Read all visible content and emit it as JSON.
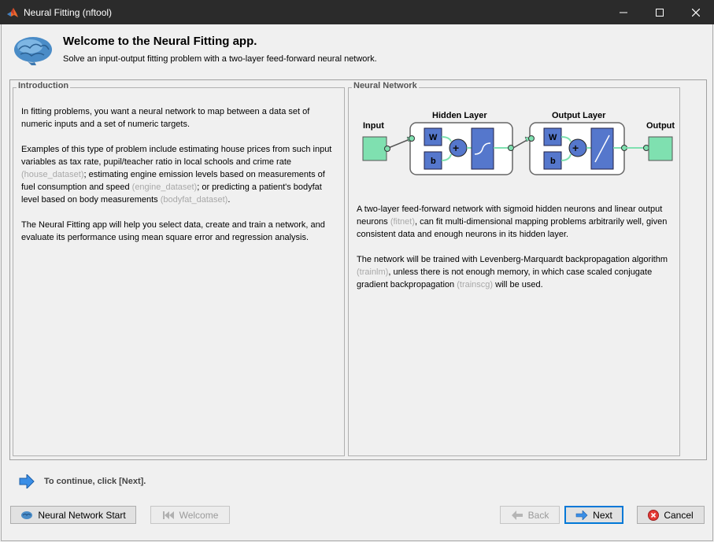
{
  "window": {
    "title": "Neural Fitting (nftool)",
    "controls": {
      "minimize": "—",
      "maximize": "☐",
      "close": "✕"
    }
  },
  "header": {
    "title": "Welcome to the Neural Fitting app.",
    "subtitle": "Solve an input-output fitting problem with a two-layer feed-forward neural network."
  },
  "introduction": {
    "legend": "Introduction",
    "p1": "In fitting problems, you want a neural network to map between a data set of numeric inputs and a set of numeric targets.",
    "p2_a": "Examples of this type of problem include estimating house prices from such input variables as tax rate, pupil/teacher ratio in local schools and crime rate ",
    "p2_link1": "(house_dataset)",
    "p2_b": "; estimating engine emission levels based on measurements of fuel consumption and speed ",
    "p2_link2": "(engine_dataset)",
    "p2_c": "; or predicting a patient's bodyfat level based on body measurements ",
    "p2_link3": "(bodyfat_dataset)",
    "p2_d": ".",
    "p3": "The Neural Fitting app will help you select data, create and train a network, and evaluate its performance using mean square error and regression analysis."
  },
  "network": {
    "legend": "Neural Network",
    "diagram": {
      "input_label": "Input",
      "hidden_label": "Hidden Layer",
      "output_layer_label": "Output Layer",
      "output_label": "Output",
      "w": "W",
      "b": "b",
      "plus": "+"
    },
    "p1_a": "A two-layer feed-forward network with sigmoid hidden neurons and linear output neurons ",
    "p1_link": "(fitnet)",
    "p1_b": ", can fit multi-dimensional mapping problems arbitrarily well, given consistent data and enough neurons in its hidden layer.",
    "p2_a": "The network will be trained with Levenberg-Marquardt backpropagation algorithm ",
    "p2_link1": "(trainlm)",
    "p2_b": ", unless there is not enough memory, in which case scaled conjugate gradient backpropagation ",
    "p2_link2": "(trainscg)",
    "p2_c": " will be used."
  },
  "footer": {
    "continue_text": "To continue, click [Next].",
    "buttons": {
      "nn_start": "Neural Network Start",
      "welcome": "Welcome",
      "back": "Back",
      "next": "Next",
      "cancel": "Cancel"
    }
  },
  "colors": {
    "titlebar": "#2b2b2b",
    "panel": "#f0f0f0",
    "node_green": "#7fe0b0",
    "box_blue": "#5577cc",
    "link_grey": "#a8a8a8",
    "accent": "#0078d7"
  }
}
